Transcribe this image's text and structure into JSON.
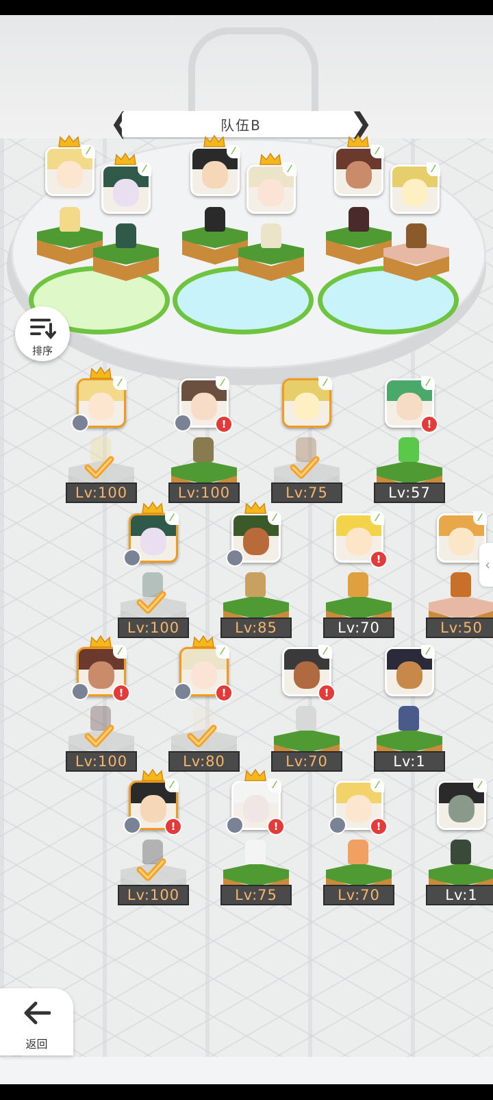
{
  "team": {
    "name": "队伍B"
  },
  "sort": {
    "label": "排序"
  },
  "back": {
    "label": "返回"
  },
  "team_members": [
    {
      "hair": "#f3d98a",
      "skin": "#fde6d0",
      "crown": true,
      "leaf": "⌐",
      "sprite": "#f3d98a",
      "pool": "green"
    },
    {
      "hair": "#2f5a4a",
      "skin": "#e9dff0",
      "crown": true,
      "leaf": "⌐",
      "sprite": "#2f5a4a",
      "pool": "green"
    },
    {
      "hair": "#2a2a2a",
      "skin": "#f6d7b8",
      "crown": true,
      "leaf": "⌐",
      "sprite": "#2a2a2a",
      "pool": "blue"
    },
    {
      "hair": "#ece4c8",
      "skin": "#fbe3d6",
      "crown": true,
      "leaf": "⌐",
      "sprite": "#ece4c8",
      "pool": "blue"
    },
    {
      "hair": "#6b3a2c",
      "skin": "#c98b6a",
      "crown": true,
      "leaf": "⌐",
      "sprite": "#4a2a2a",
      "pool": "blue"
    },
    {
      "hair": "#e6cf6a",
      "skin": "#fff0c4",
      "crown": false,
      "leaf": "⌐",
      "sprite": "#8a5a2a",
      "pool": "blue"
    }
  ],
  "roster": [
    {
      "level": "Lv:100",
      "max": true,
      "in_team": true,
      "crown": true,
      "rank": true,
      "alert": false,
      "hair": "#f3d98a",
      "skin": "#fde6d0",
      "sprite": "#f3d98a"
    },
    {
      "level": "Lv:100",
      "max": true,
      "in_team": false,
      "crown": false,
      "rank": true,
      "alert": true,
      "hair": "#6b5040",
      "skin": "#f7dcc8",
      "sprite": "#8a7a50"
    },
    {
      "level": "Lv:75",
      "max": true,
      "in_team": true,
      "crown": false,
      "rank": false,
      "alert": false,
      "hair": "#e6cf6a",
      "skin": "#fff0c4",
      "sprite": "#8a5a2a",
      "selected": true
    },
    {
      "level": "Lv:57",
      "max": false,
      "in_team": false,
      "crown": false,
      "rank": false,
      "alert": true,
      "hair": "#4aa86a",
      "skin": "#f6dcc4",
      "sprite": "#5ac84a"
    },
    {
      "level": "Lv:100",
      "max": true,
      "in_team": true,
      "crown": true,
      "rank": true,
      "alert": false,
      "hair": "#2f5a4a",
      "skin": "#e9dff0",
      "sprite": "#2f5a4a"
    },
    {
      "level": "Lv:85",
      "max": true,
      "in_team": false,
      "crown": true,
      "rank": true,
      "alert": false,
      "hair": "#3a5a2a",
      "skin": "#b86a3a",
      "sprite": "#c8a060"
    },
    {
      "level": "Lv:70",
      "max": false,
      "in_team": false,
      "crown": false,
      "rank": false,
      "alert": true,
      "hair": "#f2d34a",
      "skin": "#fde6c8",
      "sprite": "#e0a040"
    },
    {
      "level": "Lv:50",
      "max": true,
      "in_team": false,
      "crown": false,
      "rank": false,
      "alert": false,
      "hair": "#e8a84a",
      "skin": "#fbe6c8",
      "sprite": "#c8702a",
      "pink": true
    },
    {
      "level": "Lv:100",
      "max": true,
      "in_team": true,
      "crown": true,
      "rank": true,
      "alert": true,
      "hair": "#6b3a2c",
      "skin": "#c98b6a",
      "sprite": "#4a2a2a"
    },
    {
      "level": "Lv:80",
      "max": true,
      "in_team": true,
      "crown": true,
      "rank": true,
      "alert": true,
      "hair": "#ece4c8",
      "skin": "#fbe3d6",
      "sprite": "#ece4c8"
    },
    {
      "level": "Lv:70",
      "max": true,
      "in_team": false,
      "crown": false,
      "rank": false,
      "alert": true,
      "hair": "#3a3a3a",
      "skin": "#b06a40",
      "sprite": "#d8d8d8"
    },
    {
      "level": "Lv:1",
      "max": false,
      "in_team": false,
      "crown": false,
      "rank": false,
      "alert": false,
      "hair": "#2a2a3a",
      "skin": "#c8884a",
      "sprite": "#4a5a8a"
    },
    {
      "level": "Lv:100",
      "max": true,
      "in_team": true,
      "crown": true,
      "rank": true,
      "alert": true,
      "hair": "#2a2a2a",
      "skin": "#f6d7b8",
      "sprite": "#2a2a2a"
    },
    {
      "level": "Lv:75",
      "max": true,
      "in_team": false,
      "crown": true,
      "rank": true,
      "alert": true,
      "hair": "#f4f4f4",
      "skin": "#f0e6e6",
      "sprite": "#f4f4f4"
    },
    {
      "level": "Lv:70",
      "max": true,
      "in_team": false,
      "crown": false,
      "rank": true,
      "alert": true,
      "hair": "#f2d36a",
      "skin": "#fde6d0",
      "sprite": "#f0a060"
    },
    {
      "level": "Lv:1",
      "max": false,
      "in_team": false,
      "crown": false,
      "rank": false,
      "alert": false,
      "hair": "#2a2a2a",
      "skin": "#8a9a8a",
      "sprite": "#3a4a3a"
    }
  ]
}
